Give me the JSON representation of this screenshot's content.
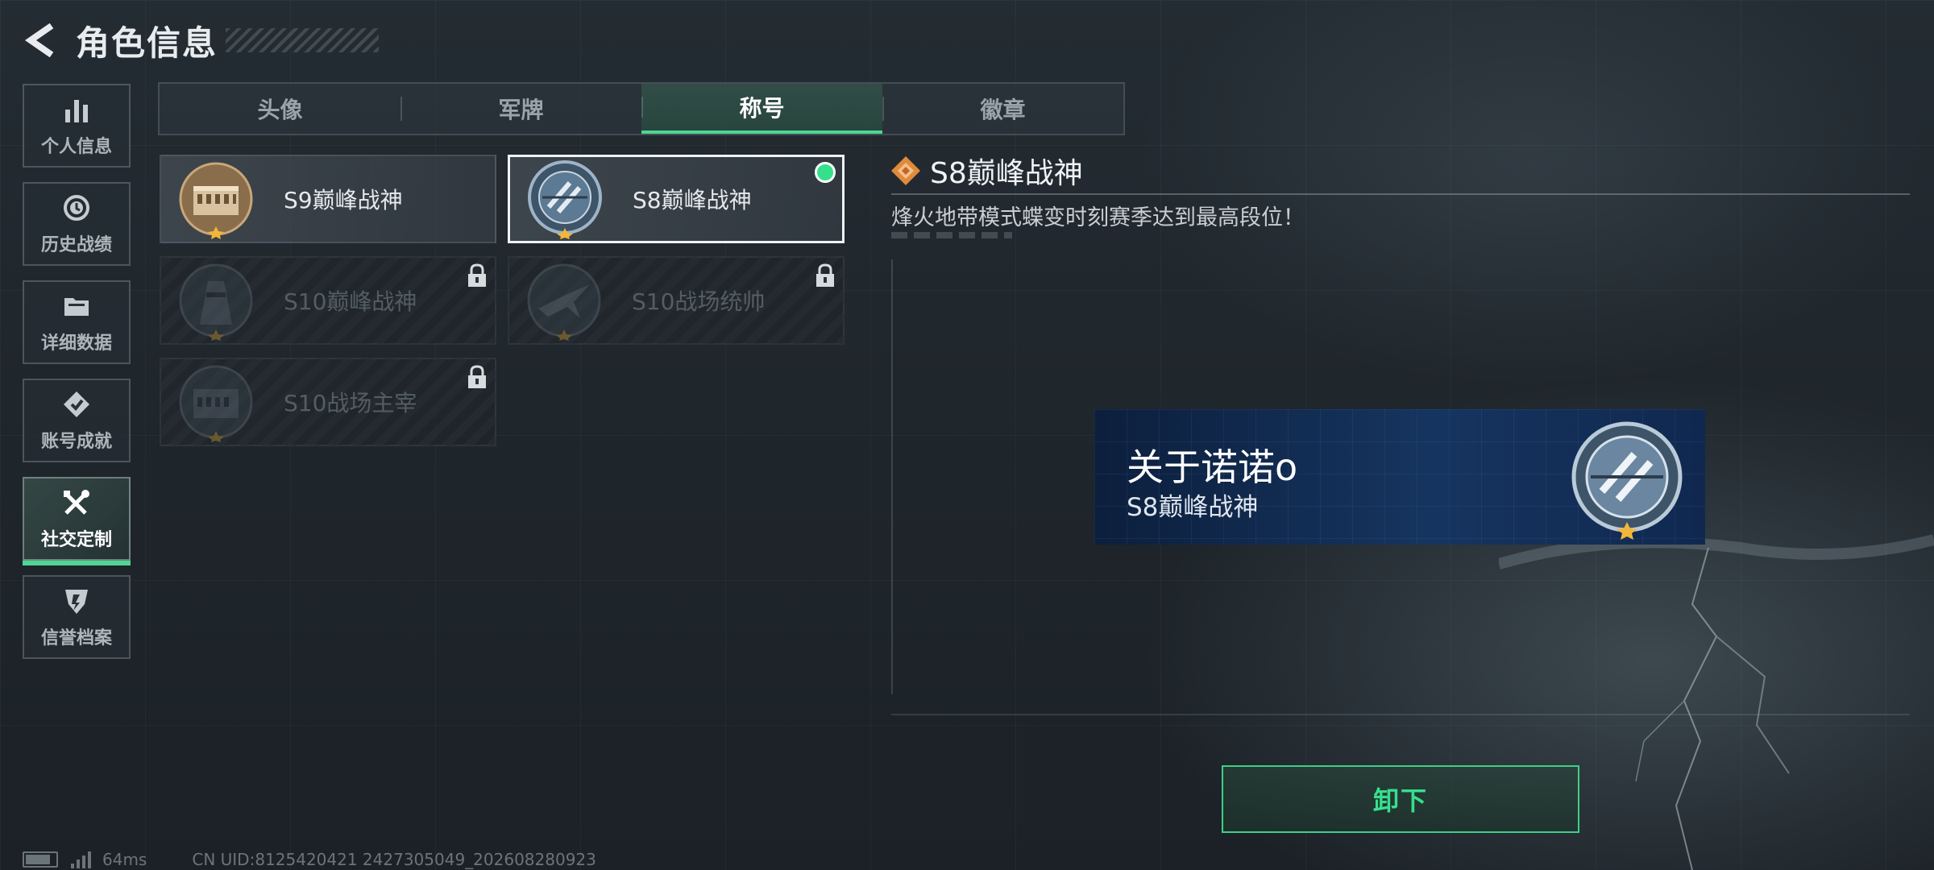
{
  "header": {
    "title": "角色信息",
    "back_icon": "back-arrow-icon"
  },
  "sidebar": {
    "items": [
      {
        "label": "个人信息",
        "icon": "bar-chart-icon",
        "active": false
      },
      {
        "label": "历史战绩",
        "icon": "clock-icon",
        "active": false
      },
      {
        "label": "详细数据",
        "icon": "folder-icon",
        "active": false
      },
      {
        "label": "账号成就",
        "icon": "achievement-icon",
        "active": false
      },
      {
        "label": "社交定制",
        "icon": "tools-icon",
        "active": true
      },
      {
        "label": "信誉档案",
        "icon": "shield-icon",
        "active": false
      }
    ]
  },
  "tabs": [
    {
      "label": "头像",
      "active": false
    },
    {
      "label": "军牌",
      "active": false
    },
    {
      "label": "称号",
      "active": true
    },
    {
      "label": "徽章",
      "active": false
    }
  ],
  "titles": [
    {
      "label": "S9巅峰战神",
      "locked": false,
      "selected": false,
      "equipped": false,
      "emblem": "colosseum-emblem-icon"
    },
    {
      "label": "S8巅峰战神",
      "locked": false,
      "selected": true,
      "equipped": true,
      "emblem": "s8-emblem-icon"
    },
    {
      "label": "S10巅峰战神",
      "locked": true,
      "selected": false,
      "equipped": false,
      "emblem": "tower-emblem-icon"
    },
    {
      "label": "S10战场统帅",
      "locked": true,
      "selected": false,
      "equipped": false,
      "emblem": "plane-emblem-icon"
    },
    {
      "label": "S10战场主宰",
      "locked": true,
      "selected": false,
      "equipped": false,
      "emblem": "colosseum-emblem-icon"
    }
  ],
  "detail": {
    "title": "S8巅峰战神",
    "description": "烽火地带模式蝶变时刻赛季达到最高段位！"
  },
  "preview": {
    "player_name": "关于诺诺o",
    "title": "S8巅峰战神"
  },
  "actions": {
    "unequip_label": "卸下"
  },
  "status": {
    "ping": "64ms",
    "uid": "CN UID:8125420421 2427305049_202608280923"
  },
  "colors": {
    "accent": "#35e08c",
    "gold": "#f3b63a",
    "preview_bg": "#122848"
  }
}
